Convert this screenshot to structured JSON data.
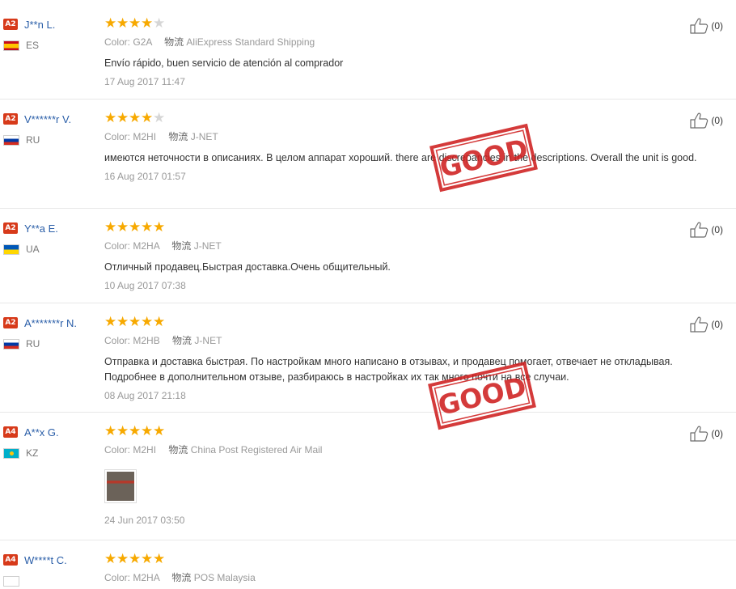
{
  "colors": {
    "star_filled": "#f7a900",
    "star_empty": "#d6d6d6",
    "buyer_name": "#2a5ea8",
    "badge": "#d73a1a",
    "stamp": "#cf1f1f"
  },
  "stamp_text": "GOOD",
  "reviews": [
    {
      "level": "A2",
      "buyer": "J**n L.",
      "country": "ES",
      "rating": 4,
      "color_label": "Color:",
      "color_value": "G2A",
      "shipping_label": "物流",
      "shipping_value": "AliExpress Standard Shipping",
      "text": "Envío rápido, buen servicio de atención al comprador",
      "date": "17 Aug 2017 11:47",
      "helpful": "(0)"
    },
    {
      "level": "A2",
      "buyer": "V******r V.",
      "country": "RU",
      "rating": 4,
      "color_label": "Color:",
      "color_value": "M2HI",
      "shipping_label": "物流",
      "shipping_value": "J-NET",
      "text": "имеются неточности в описаниях. В целом аппарат хороший. there are discrepancies in the descriptions. Overall the unit is good.",
      "date": "16 Aug 2017 01:57",
      "helpful": "(0)"
    },
    {
      "level": "A2",
      "buyer": "Y**a E.",
      "country": "UA",
      "rating": 5,
      "color_label": "Color:",
      "color_value": "M2HA",
      "shipping_label": "物流",
      "shipping_value": "J-NET",
      "text": "Отличный продавец.Быстрая доставка.Очень общительный.",
      "date": "10 Aug 2017 07:38",
      "helpful": "(0)"
    },
    {
      "level": "A2",
      "buyer": "A*******r N.",
      "country": "RU",
      "rating": 5,
      "color_label": "Color:",
      "color_value": "M2HB",
      "shipping_label": "物流",
      "shipping_value": "J-NET",
      "text": "Отправка и доставка быстрая. По настройкам много написано в отзывах, и продавец помогает, отвечает не откладывая. Подробнее в дополнительном отзыве, разбираюсь в настройках их так много почти на все случаи.",
      "date": "08 Aug 2017 21:18",
      "helpful": "(0)"
    },
    {
      "level": "A4",
      "buyer": "A**x G.",
      "country": "KZ",
      "rating": 5,
      "color_label": "Color:",
      "color_value": "M2HI",
      "shipping_label": "物流",
      "shipping_value": "China Post Registered Air Mail",
      "text": "",
      "date": "24 Jun 2017 03:50",
      "helpful": "(0)"
    },
    {
      "level": "A4",
      "buyer": "W****t C.",
      "country": "",
      "rating": 5,
      "color_label": "Color:",
      "color_value": "M2HA",
      "shipping_label": "物流",
      "shipping_value": "POS Malaysia",
      "text": "",
      "date": "",
      "helpful": ""
    }
  ]
}
